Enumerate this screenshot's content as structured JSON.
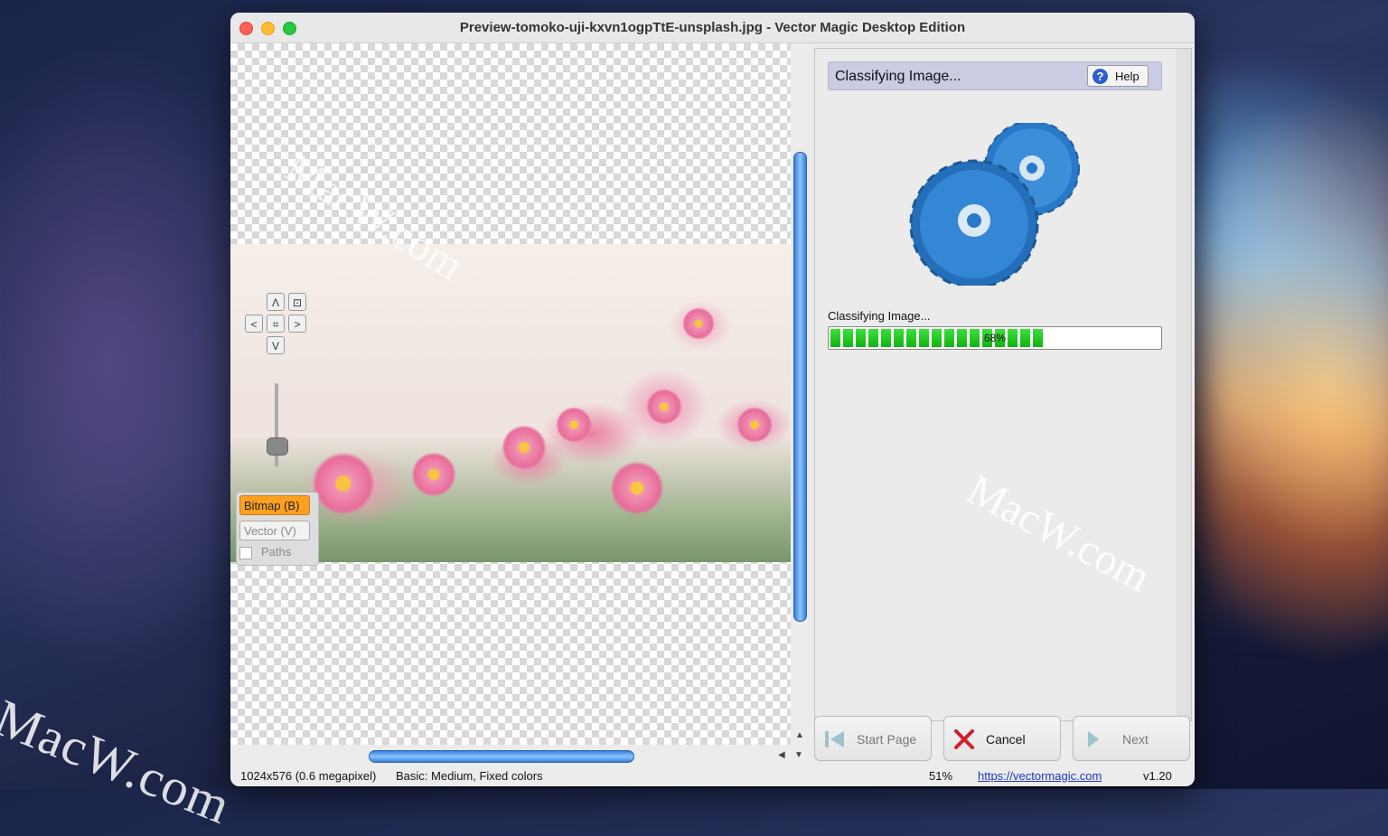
{
  "window": {
    "title": "Preview-tomoko-uji-kxvn1ogpTtE-unsplash.jpg - Vector Magic Desktop Edition"
  },
  "watermarks": {
    "text": "MacW.com"
  },
  "navigation": {
    "up": "Λ",
    "down": "V",
    "left": "<",
    "right": ">",
    "center": "⌗",
    "fit": "⊡"
  },
  "mode_panel": {
    "bitmap_label": "Bitmap (B)",
    "vector_label": "Vector (V)",
    "paths_label": "Paths"
  },
  "right_panel": {
    "header_title": "Classifying Image...",
    "help_label": "Help",
    "progress_label": "Classifying Image...",
    "progress_percent": 68,
    "progress_text": "68%"
  },
  "buttons": {
    "start_page": "Start Page",
    "cancel": "Cancel",
    "next": "Next"
  },
  "status_bar": {
    "image_info": "1024x576 (0.6 megapixel)",
    "settings": "Basic: Medium, Fixed colors",
    "zoom": "51%",
    "link": "https://vectormagic.com",
    "version": "v1.20"
  },
  "colors": {
    "accent_orange": "#ffa020",
    "progress_green": "#1fc41f",
    "scroll_blue": "#3a7fd8",
    "cancel_red": "#d0202a"
  }
}
